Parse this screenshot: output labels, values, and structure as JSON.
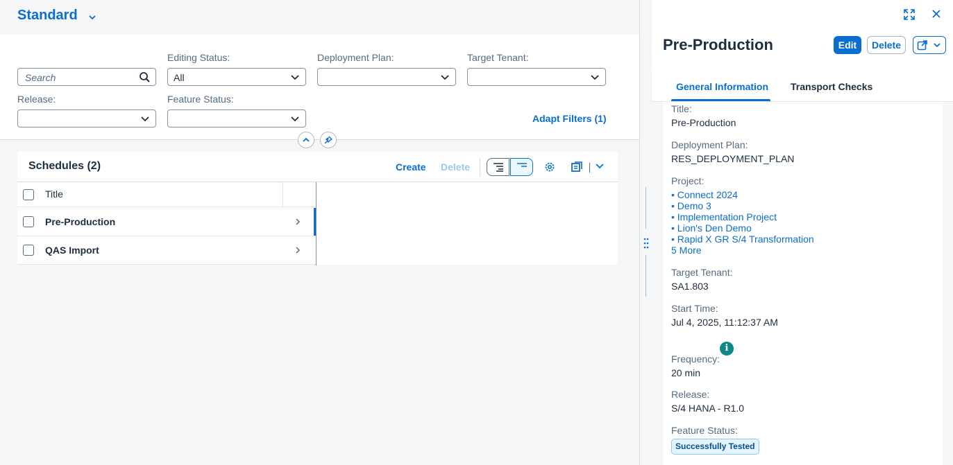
{
  "variant": {
    "title": "Standard"
  },
  "filters": {
    "search_placeholder": "Search",
    "editing_status_label": "Editing Status:",
    "editing_status_value": "All",
    "deployment_plan_label": "Deployment Plan:",
    "deployment_plan_value": "",
    "target_tenant_label": "Target Tenant:",
    "target_tenant_value": "",
    "release_label": "Release:",
    "release_value": "",
    "feature_status_label": "Feature Status:",
    "feature_status_value": "",
    "adapt_filters": "Adapt Filters (1)"
  },
  "table": {
    "title": "Schedules (2)",
    "create_label": "Create",
    "delete_label": "Delete",
    "column_title": "Title",
    "rows": [
      {
        "title": "Pre-Production",
        "selected": true
      },
      {
        "title": "QAS Import",
        "selected": false
      }
    ]
  },
  "detail": {
    "title": "Pre-Production",
    "edit_label": "Edit",
    "delete_label": "Delete",
    "tabs": [
      {
        "label": "General Information",
        "active": true
      },
      {
        "label": "Transport Checks",
        "active": false
      }
    ],
    "fields": {
      "title_label": "Title:",
      "title_value": "Pre-Production",
      "deployment_plan_label": "Deployment Plan:",
      "deployment_plan_value": "RES_DEPLOYMENT_PLAN",
      "project_label": "Project:",
      "projects": [
        "• Connect 2024",
        "• Demo 3",
        "• Implementation Project",
        "• Lion's Den Demo",
        "• Rapid X GR S/4 Transformation"
      ],
      "more_projects": "5 More",
      "target_tenant_label": "Target Tenant:",
      "target_tenant_value": "SA1.803",
      "start_time_label": "Start Time:",
      "start_time_value": "Jul 4, 2025, 11:12:37 AM",
      "frequency_label": "Frequency:",
      "frequency_value": "20 min",
      "release_label": "Release:",
      "release_value": "S/4 HANA - R1.0",
      "feature_status_label": "Feature Status:",
      "feature_status_value": "Successfully Tested"
    }
  },
  "colors": {
    "accent": "#0a6ed1",
    "info": "#0c8a8a",
    "badge_bg": "#e4f4ff"
  },
  "icons": [
    "chevron-down-icon",
    "search-icon",
    "collapse-icon",
    "pin-icon",
    "settings-icon",
    "export-icon",
    "fullscreen-icon",
    "close-icon",
    "share-icon",
    "info-icon",
    "grip-icon"
  ]
}
